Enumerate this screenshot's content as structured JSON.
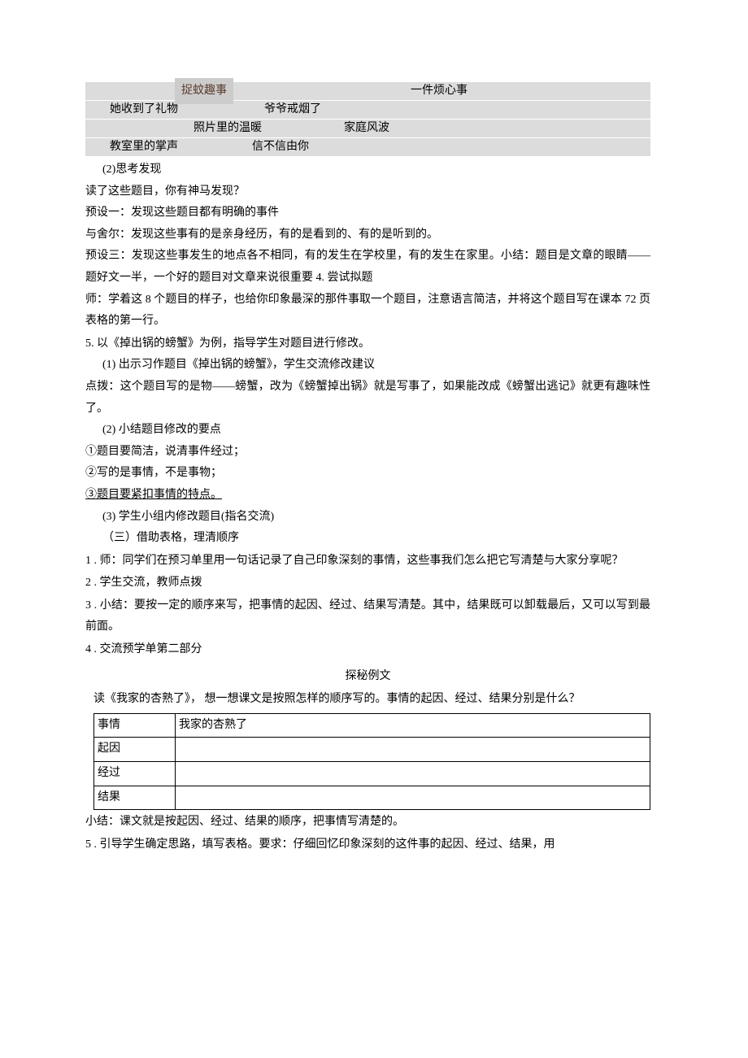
{
  "titleRows": {
    "row1": {
      "t1": "捉蚊趣事",
      "t2": "一件烦心事"
    },
    "row2": {
      "t1": "她收到了礼物",
      "t2": "爷爷戒烟了"
    },
    "row3": {
      "t1": "照片里的温暖",
      "t2": "家庭风波"
    },
    "row4": {
      "t1": "教室里的掌声",
      "t2": "信不信由你"
    }
  },
  "section1": {
    "heading": "(2)思考发现",
    "line1": "读了这些题目，你有神马发现？",
    "line2": "预设一：发现这些题目都有明确的事件",
    "line3": "与舍尔：发现这些事有的是亲身经历，有的是看到的、有的是听到的。",
    "line4": "预设三：发现这些事发生的地点各不相同，有的发生在学校里，有的发生在家里。小结：题目是文章的眼睛——题好文一半，一个好的题目对文章来说很重要 4. 尝试拟题",
    "line5": "师：学着这 8 个题目的样子，也给你印象最深的那件事取一个题目，注意语言简洁，并将这个题目写在课本 72 页表格的第一行。",
    "item5": "5. 以《掉出锅的螃蟹》为例，指导学生对题目进行修改。",
    "sub1": "(1) 出示习作题目《掉出锅的螃蟹》，学生交流修改建议",
    "dianbo": "点拨：这个题目写的是物——螃蟹，改为《螃蟹掉出锅》就是写事了，如果能改成《螃蟹出逃记》就更有趣味性了。",
    "sub2": "(2) 小结题目修改的要点",
    "circ1": "①题目要简洁，说清事件经过；",
    "circ2": "②写的是事情，不是事物；",
    "circ3": "③题目要紧扣事情的特点。",
    "sub3": "(3) 学生小组内修改题目(指名交流)",
    "sub4": "（三）借助表格，理清顺序",
    "n1": "1 . 师：同学们在预习单里用一句话记录了自己印象深刻的事情，这些事我们怎么把它写清楚与大家分享呢？",
    "n2": "2 . 学生交流，教师点拨",
    "n3": "3 . 小结：要按一定的顺序来写，把事情的起因、经过、结果写清楚。其中，结果既可以卸载最后，又可以写到最前面。",
    "n4": "4 . 交流预学单第二部分"
  },
  "exploreTitle": "探秘例文",
  "exploreText": "读《我家的杏熟了》， 想一想课文是按照怎样的顺序写的。事情的起因、经过、结果分别是什么？",
  "table": {
    "r1c1": "事情",
    "r1c2": "我家的杏熟了",
    "r2c1": "起因",
    "r3c1": "经过",
    "r4c1": "结果"
  },
  "afterTable": {
    "summary": "小结：课文就是按起因、经过、结果的顺序，把事情写清楚的。",
    "n5": "5 . 引导学生确定思路，填写表格。要求：仔细回忆印象深刻的这件事的起因、经过、结果，用"
  }
}
